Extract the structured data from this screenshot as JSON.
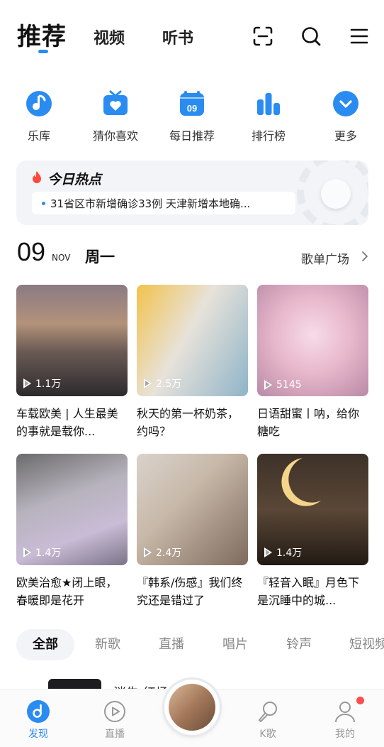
{
  "header": {
    "tab_active": "推荐",
    "tab_video": "视频",
    "tab_book": "听书",
    "icons": [
      "scan-icon",
      "search-icon",
      "menu-icon"
    ]
  },
  "shortcuts": [
    {
      "label": "乐库",
      "icon": "music-note-icon"
    },
    {
      "label": "猜你喜欢",
      "icon": "radio-heart-icon"
    },
    {
      "label": "每日推荐",
      "icon": "calendar-icon",
      "badge": "09"
    },
    {
      "label": "排行榜",
      "icon": "bar-chart-icon"
    },
    {
      "label": "更多",
      "icon": "chevron-down-circle-icon"
    }
  ],
  "hot": {
    "title": "今日热点",
    "news": "31省区市新增确诊33例 天津新增本地确..."
  },
  "date": {
    "day": "09",
    "month": "NOV",
    "weekday": "周一",
    "plaza_label": "歌单广场"
  },
  "playlists": [
    {
      "count": "1.1万",
      "title": "车载欧美 | 人生最美的事就是载你..."
    },
    {
      "count": "2.5万",
      "title": "秋天的第一杯奶茶，约吗？"
    },
    {
      "count": "5145",
      "title": "日语甜蜜丨呐，给你糖吃"
    },
    {
      "count": "1.4万",
      "title": "欧美治愈★闭上眼，春暖即是花开"
    },
    {
      "count": "2.4万",
      "title": "『韩系/伤感』我们终究还是错过了"
    },
    {
      "count": "1.4万",
      "title": "『轻音入眠』月色下是沉睡中的城..."
    }
  ],
  "categories": [
    "全部",
    "新歌",
    "直播",
    "唱片",
    "铃声",
    "短视频"
  ],
  "peek": {
    "text": "消失 红场"
  },
  "bottom_nav": [
    {
      "label": "发现",
      "icon": "discover-icon"
    },
    {
      "label": "直播",
      "icon": "live-play-icon"
    },
    {
      "label": "K歌",
      "icon": "microphone-icon"
    },
    {
      "label": "我的",
      "icon": "user-icon"
    }
  ],
  "colors": {
    "accent": "#2a8cf0",
    "notification": "#ff4d4f"
  }
}
